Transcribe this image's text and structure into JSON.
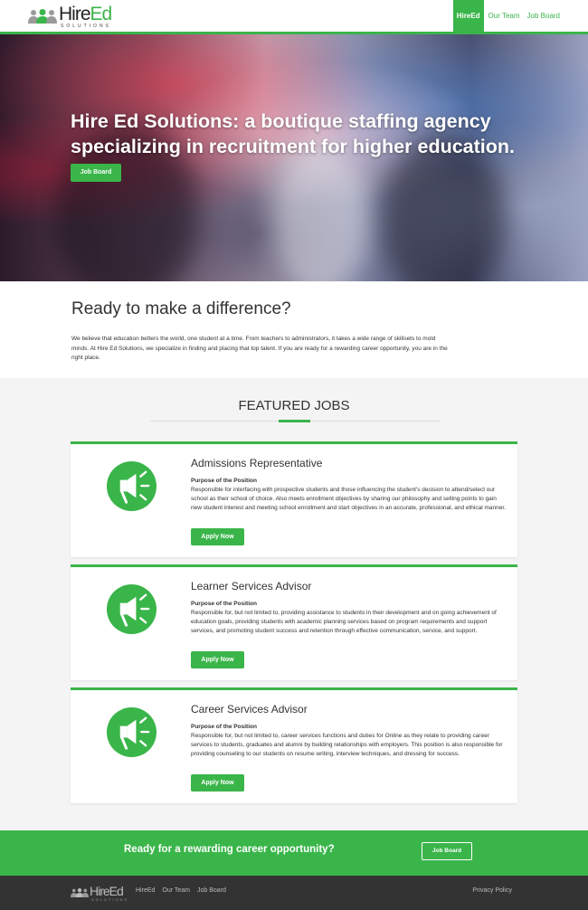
{
  "header": {
    "logo_main_1": "Hire",
    "logo_main_2": "Ed",
    "logo_sub": "SOLUTIONS",
    "nav": [
      "HireEd",
      "Our Team",
      "Job Board"
    ]
  },
  "hero": {
    "title": "Hire Ed Solutions: a boutique staffing agency specializing in recruitment for higher education.",
    "button": "Job Board"
  },
  "about": {
    "heading": "Ready to make a difference?",
    "body": "We believe that education betters the world, one student at a time. From teachers to administrators, it takes a wide range of skillsets to mold minds. At Hire Ed Solutions, we specialize in finding and placing that top talent. If you are ready for a rewarding career opportunity, you are in the right place."
  },
  "jobs": {
    "heading": "FEATURED JOBS",
    "items": [
      {
        "title": "Admissions Representative",
        "subtitle": "Purpose of the Position",
        "description": "Responsible for interfacing with prospective students and those influencing the student's decision to attend/select our school as their school of choice. Also meets enrollment objectives by sharing our philosophy and selling points to gain new student interest and meeting school enrollment and start objectives in an accurate, professional, and ethical manner.",
        "button": "Apply Now"
      },
      {
        "title": "Learner Services Advisor",
        "subtitle": "Purpose of the Position",
        "description": "Responsible for, but not limited to, providing assistance to students in their development and on going achievement of education goals, providing students with academic planning services based on program requirements and support services, and promoting student success and retention through effective communication, service, and support.",
        "button": "Apply Now"
      },
      {
        "title": "Career Services Advisor",
        "subtitle": "Purpose of the Position",
        "description": "Responsible for, but not limited to, career services functions and duties for Online as they relate to providing career services to students, graduates and alumni by building relationships with employers. This position is also responsible for providing counseling to our students on resume writing, interview techniques, and dressing for success.",
        "button": "Apply Now"
      }
    ]
  },
  "cta": {
    "text": "Ready for a rewarding career opportunity?",
    "button": "Job Board"
  },
  "footer": {
    "logo_main_1": "Hire",
    "logo_main_2": "Ed",
    "logo_sub": "SOLUTIONS",
    "nav": [
      "HireEd",
      "Our Team",
      "Job Board"
    ],
    "privacy": "Privacy Policy"
  },
  "colors": {
    "accent": "#3ab54a",
    "footer_bg": "#333333",
    "section_bg": "#f4f4f4"
  },
  "icons": {
    "job_card_icon": "megaphone-icon",
    "logo_icon": "people-icon"
  }
}
